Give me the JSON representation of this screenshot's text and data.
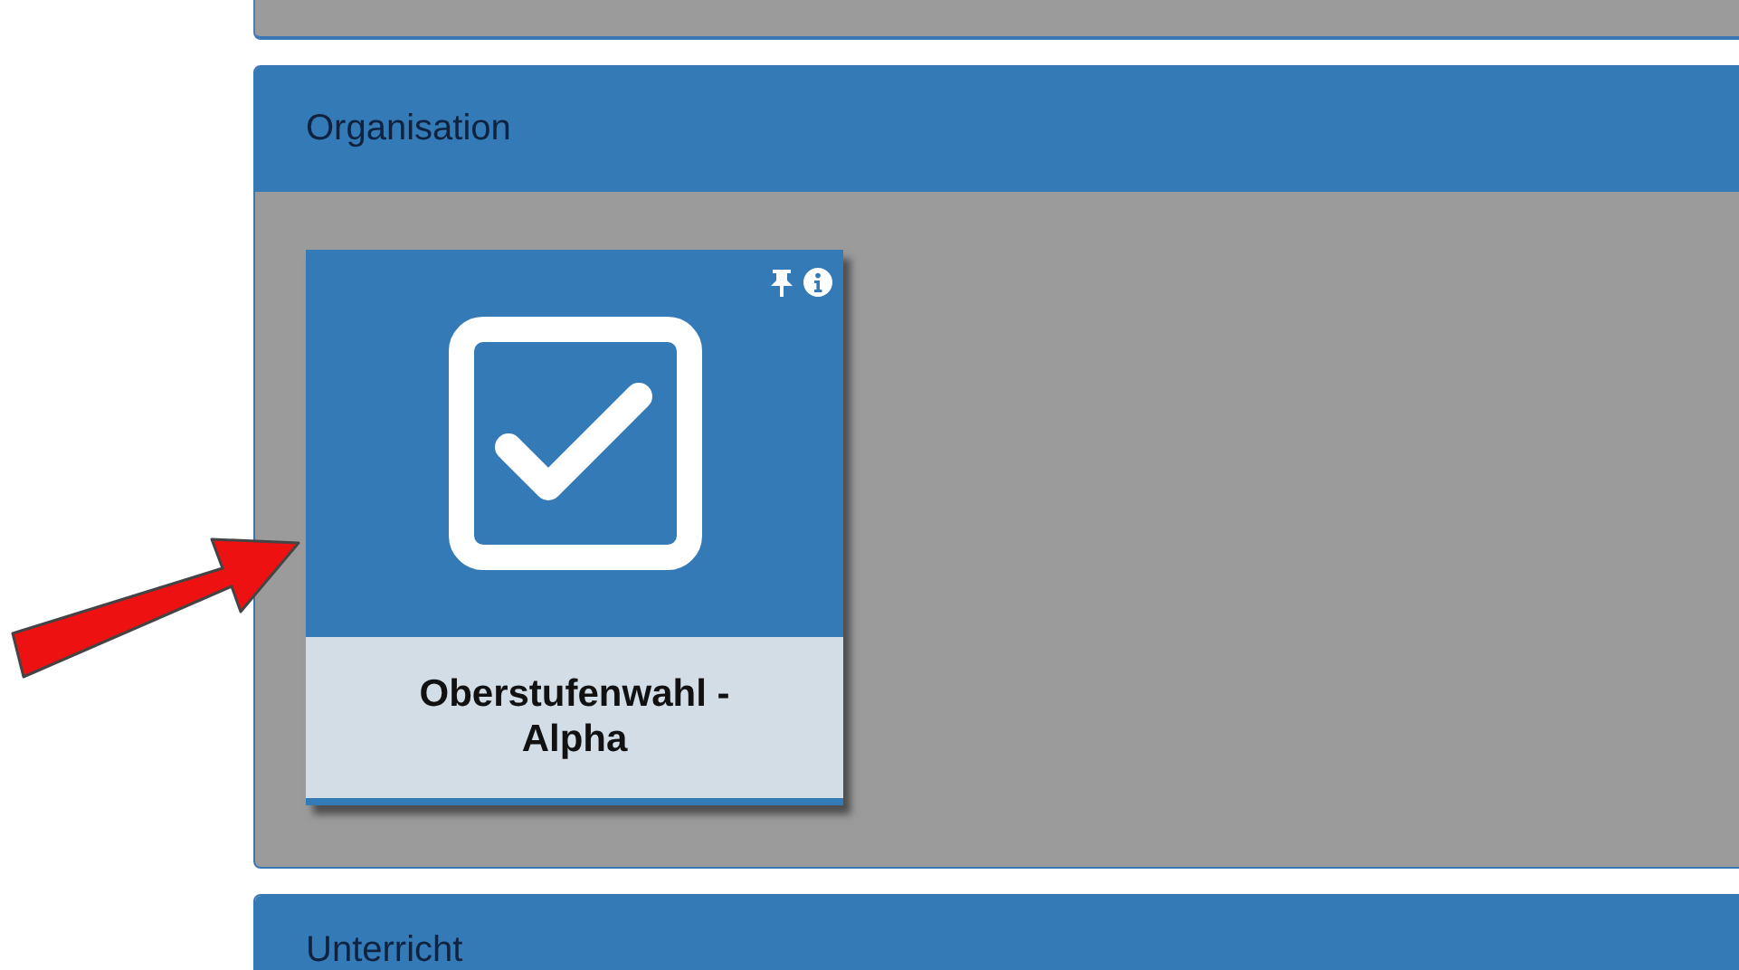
{
  "panels": [
    {
      "title": "Organisation",
      "tiles": [
        {
          "label": "Oberstufenwahl - Alpha"
        }
      ]
    },
    {
      "title": "Unterricht"
    }
  ]
}
